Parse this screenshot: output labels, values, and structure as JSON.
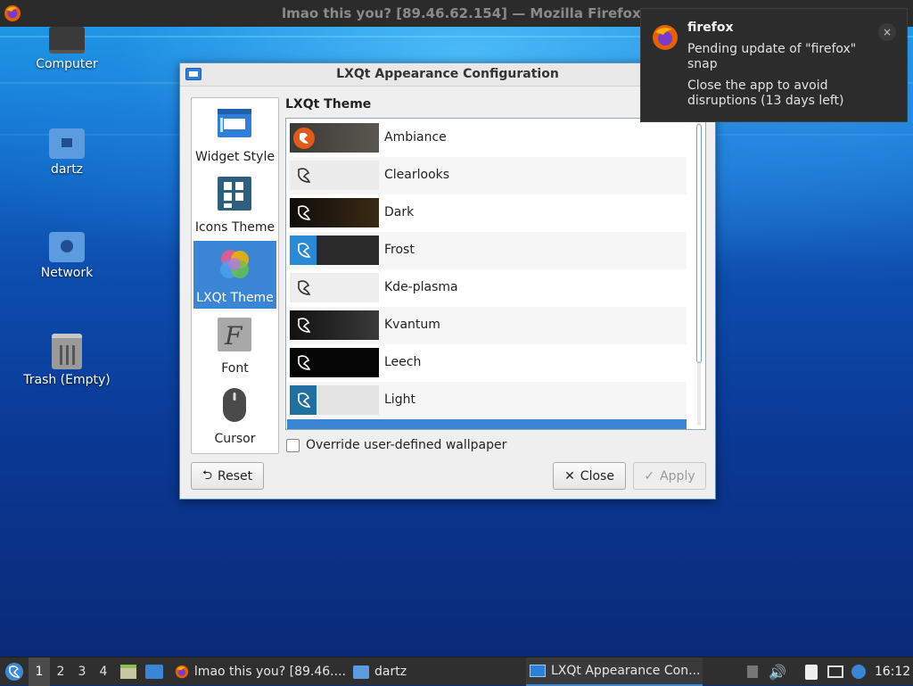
{
  "browser": {
    "title": "lmao this you? [89.46.62.154] — Mozilla Firefox"
  },
  "desktop": {
    "icons": [
      {
        "label": "Computer",
        "icon": "computer-icon"
      },
      {
        "label": "dartz",
        "icon": "home-folder-icon"
      },
      {
        "label": "Network",
        "icon": "network-folder-icon"
      },
      {
        "label": "Trash (Empty)",
        "icon": "trash-icon"
      }
    ]
  },
  "dialog": {
    "title": "LXQt Appearance Configuration",
    "sidebar": [
      {
        "label": "Widget Style",
        "icon": "widget-style-icon",
        "active": false
      },
      {
        "label": "Icons Theme",
        "icon": "icons-theme-icon",
        "active": false
      },
      {
        "label": "LXQt Theme",
        "icon": "lxqt-theme-icon",
        "active": true
      },
      {
        "label": "Font",
        "icon": "font-icon",
        "active": false
      },
      {
        "label": "Cursor",
        "icon": "cursor-icon",
        "active": false
      }
    ],
    "section_title": "LXQt Theme",
    "themes": [
      {
        "name": "Ambiance"
      },
      {
        "name": "Clearlooks"
      },
      {
        "name": "Dark"
      },
      {
        "name": "Frost"
      },
      {
        "name": "Kde-plasma"
      },
      {
        "name": "Kvantum"
      },
      {
        "name": "Leech"
      },
      {
        "name": "Light"
      }
    ],
    "override_label": "Override user-defined wallpaper",
    "override_checked": false,
    "buttons": {
      "reset": "Reset",
      "close": "Close",
      "apply": "Apply"
    }
  },
  "notification": {
    "app": "firefox",
    "message": "Pending update of \"firefox\" snap",
    "detail": "Close the app to avoid disruptions (13 days left)",
    "close_glyph": "×"
  },
  "taskbar": {
    "desktops": [
      "1",
      "2",
      "3",
      "4"
    ],
    "active_desktop": "1",
    "tasks": [
      {
        "label": "lmao this you? [89.46....",
        "icon": "firefox-icon"
      },
      {
        "label": "dartz",
        "icon": "folder-icon"
      },
      {
        "label": "LXQt Appearance Con...",
        "icon": "appearance-icon"
      }
    ],
    "clock": "16:12"
  },
  "colors": {
    "accent": "#3b86d4",
    "taskbar_bg": "#2f2f2f",
    "dialog_bg": "#efefef"
  }
}
